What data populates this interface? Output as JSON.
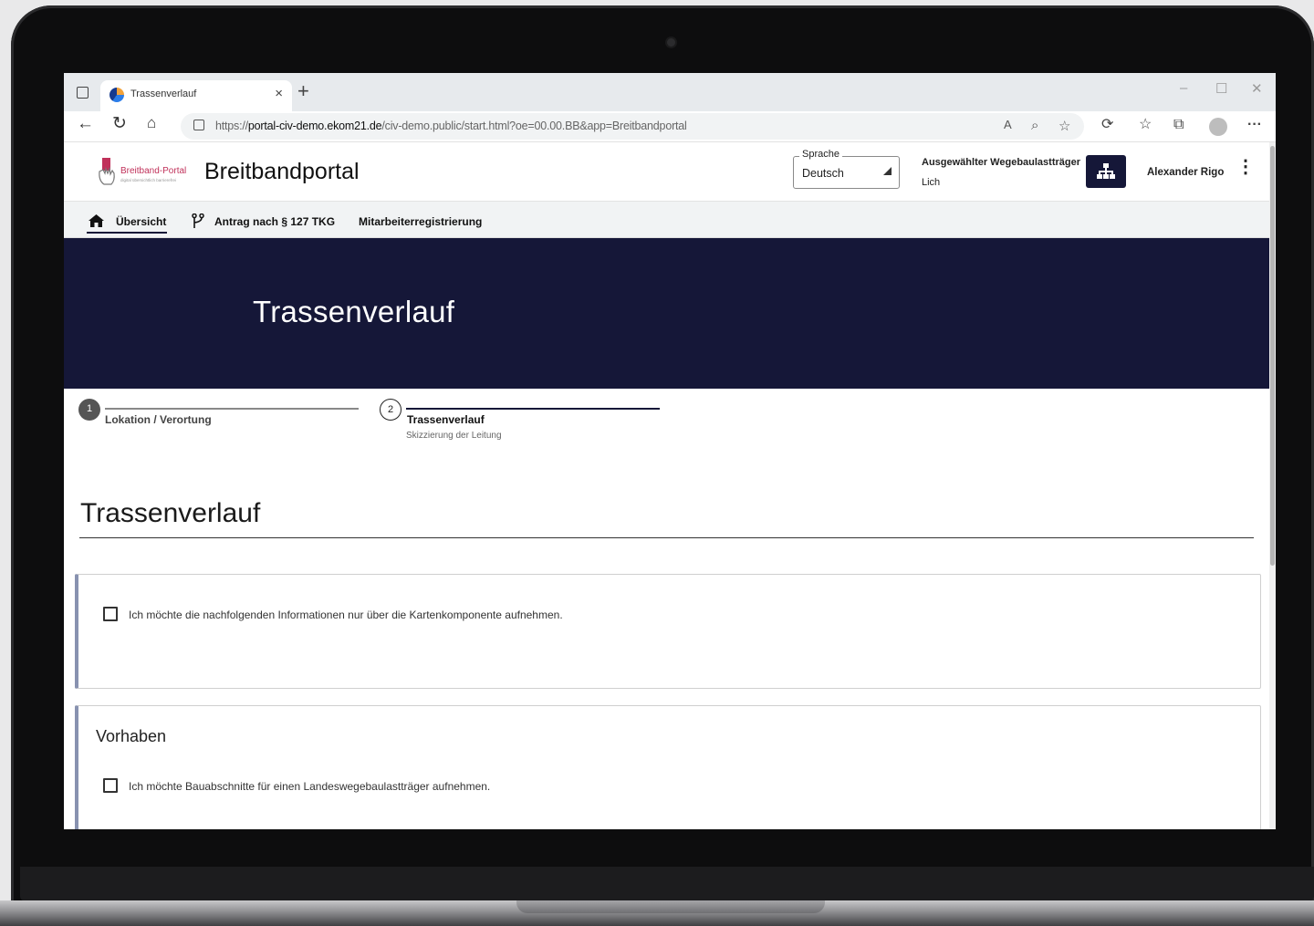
{
  "browser": {
    "tab_title": "Trassenverlauf",
    "tab_close": "×",
    "new_tab": "+",
    "url_prefix": "https://",
    "url_host": "portal-civ-demo.ekom21.de",
    "url_path": "/civ-demo.public/start.html?oe=00.00.BB&app=Breitbandportal",
    "window_controls": [
      "–",
      "☐",
      "✕"
    ]
  },
  "header": {
    "logo_text": "Breitband-Portal",
    "logo_subtext": "digital übersichtlich barrierefrei",
    "app_title": "Breitbandportal",
    "language_label": "Sprache",
    "language_value": "Deutsch",
    "carrier_label": "Ausgewählter Wegebaulastträger",
    "carrier_value": "Lich",
    "user_name": "Alexander Rigo",
    "menu_icon": "⋮"
  },
  "nav": {
    "items": [
      {
        "label": "Übersicht",
        "icon": "home-icon",
        "active": true
      },
      {
        "label": "Antrag nach § 127 TKG",
        "icon": "branch-icon",
        "active": false
      },
      {
        "label": "Mitarbeiterregistrierung",
        "icon": "",
        "active": false
      }
    ]
  },
  "hero": {
    "title": "Trassenverlauf"
  },
  "stepper": {
    "steps": [
      {
        "number": "1",
        "label": "Lokation / Verortung",
        "sublabel": "",
        "state": "completed"
      },
      {
        "number": "2",
        "label": "Trassenverlauf",
        "sublabel": "Skizzierung der Leitung",
        "state": "active"
      }
    ]
  },
  "main": {
    "section_title": "Trassenverlauf",
    "map_only_checkbox_label": "Ich möchte die nachfolgenden Informationen nur über die Kartenkomponente aufnehmen.",
    "map_only_checked": false,
    "vorhaben_title": "Vorhaben",
    "bauabschnitte_checkbox_label": "Ich möchte Bauabschnitte für einen Landeswegebaulastträger aufnehmen.",
    "bauabschnitte_checked": false
  },
  "colors": {
    "brand_navy": "#151738",
    "card_accent": "#8892b0",
    "logo_red": "#c0315a"
  }
}
